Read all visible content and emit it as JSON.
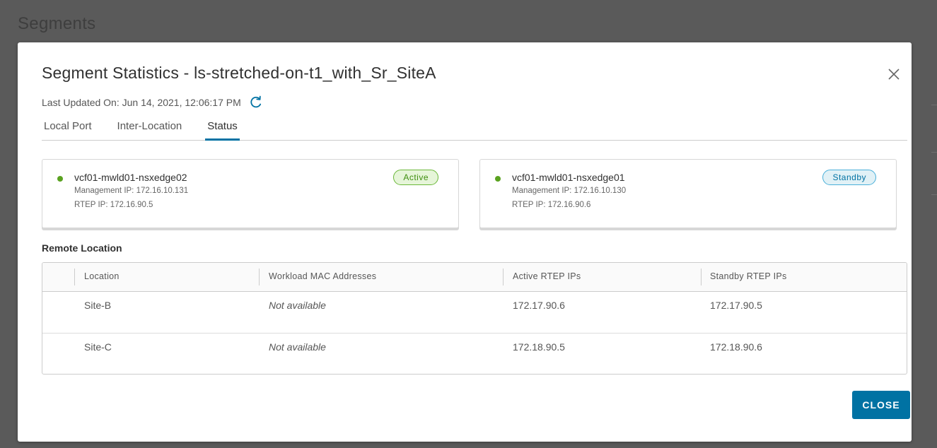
{
  "background": {
    "title": "Segments"
  },
  "modal": {
    "title": "Segment Statistics - ls-stretched-on-t1_with_Sr_SiteA",
    "last_updated": "Last Updated On: Jun 14, 2021, 12:06:17 PM",
    "tabs": [
      {
        "label": "Local Port",
        "active": false
      },
      {
        "label": "Inter-Location",
        "active": false
      },
      {
        "label": "Status",
        "active": true
      }
    ],
    "edges": [
      {
        "name": "vcf01-mwld01-nsxedge02",
        "mgmt_ip": "Management IP: 172.16.10.131",
        "rtep_ip": "RTEP IP: 172.16.90.5",
        "status": "Active",
        "status_color": "#3e8e0f"
      },
      {
        "name": "vcf01-mwld01-nsxedge01",
        "mgmt_ip": "Management IP: 172.16.10.130",
        "rtep_ip": "RTEP IP: 172.16.90.6",
        "status": "Standby",
        "status_color": "#0072a3"
      }
    ],
    "remote_location": {
      "label": "Remote Location",
      "columns": [
        "Location",
        "Workload MAC Addresses",
        "Active RTEP IPs",
        "Standby RTEP IPs"
      ],
      "rows": [
        {
          "location": "Site-B",
          "mac": "Not available",
          "active_ip": "172.17.90.6",
          "standby_ip": "172.17.90.5"
        },
        {
          "location": "Site-C",
          "mac": "Not available",
          "active_ip": "172.18.90.5",
          "standby_ip": "172.18.90.6"
        }
      ]
    },
    "close_label": "CLOSE"
  },
  "colors": {
    "accent": "#0072a3",
    "status_dot": "#5aa220"
  },
  "icons": {
    "close": "close-icon",
    "refresh": "refresh-icon",
    "status": "status-dot-icon"
  }
}
